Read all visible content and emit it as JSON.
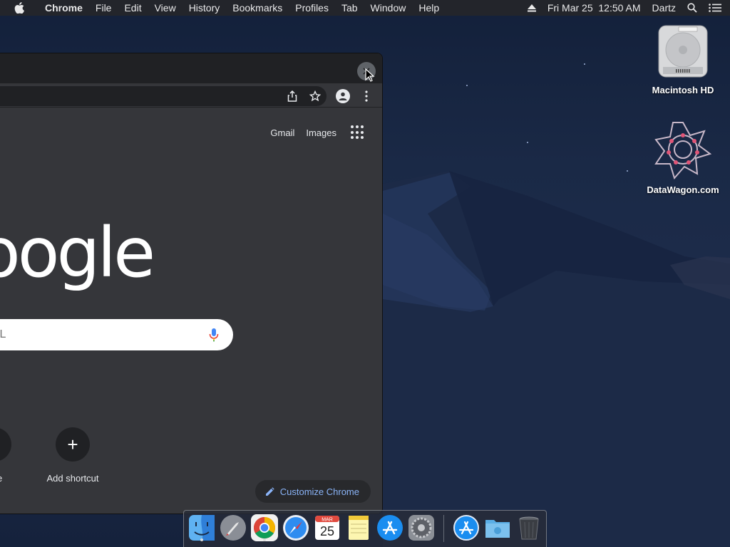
{
  "menubar": {
    "app_name": "Chrome",
    "menus": [
      "File",
      "Edit",
      "View",
      "History",
      "Bookmarks",
      "Profiles",
      "Tab",
      "Window",
      "Help"
    ],
    "clock": "Fri Mar 25  12:50 AM",
    "user": "Dartz"
  },
  "desktop": {
    "icons": [
      {
        "label": "Macintosh HD",
        "icon": "hard-drive-icon"
      },
      {
        "label": "DataWagon.com",
        "icon": "datawagon-logo-icon"
      }
    ]
  },
  "chrome": {
    "top_links": {
      "gmail": "Gmail",
      "images": "Images"
    },
    "logo_text": "oogle",
    "search_placeholder": "RL",
    "shortcuts": [
      {
        "label": "tore"
      },
      {
        "label": "Add shortcut",
        "symbol": "+"
      }
    ],
    "customize_label": "Customize Chrome"
  },
  "dock": {
    "apps": [
      {
        "name": "finder-icon",
        "running": true
      },
      {
        "name": "launchpad-icon",
        "running": false
      },
      {
        "name": "chrome-icon",
        "running": true
      },
      {
        "name": "safari-icon",
        "running": false
      },
      {
        "name": "calendar-icon",
        "running": false,
        "month": "MAR",
        "day": "25"
      },
      {
        "name": "notes-icon",
        "running": false
      },
      {
        "name": "app-store-icon",
        "running": false
      },
      {
        "name": "system-preferences-icon",
        "running": false
      },
      {
        "name": "app-store-downloads-icon",
        "running": false
      },
      {
        "name": "downloads-folder-icon",
        "running": false
      },
      {
        "name": "trash-icon",
        "running": false
      }
    ]
  },
  "colors": {
    "menubar_bg": "#23252b",
    "window_bg": "#35363a",
    "tabstrip_bg": "#202124",
    "accent_blue": "#8ab4f8"
  }
}
